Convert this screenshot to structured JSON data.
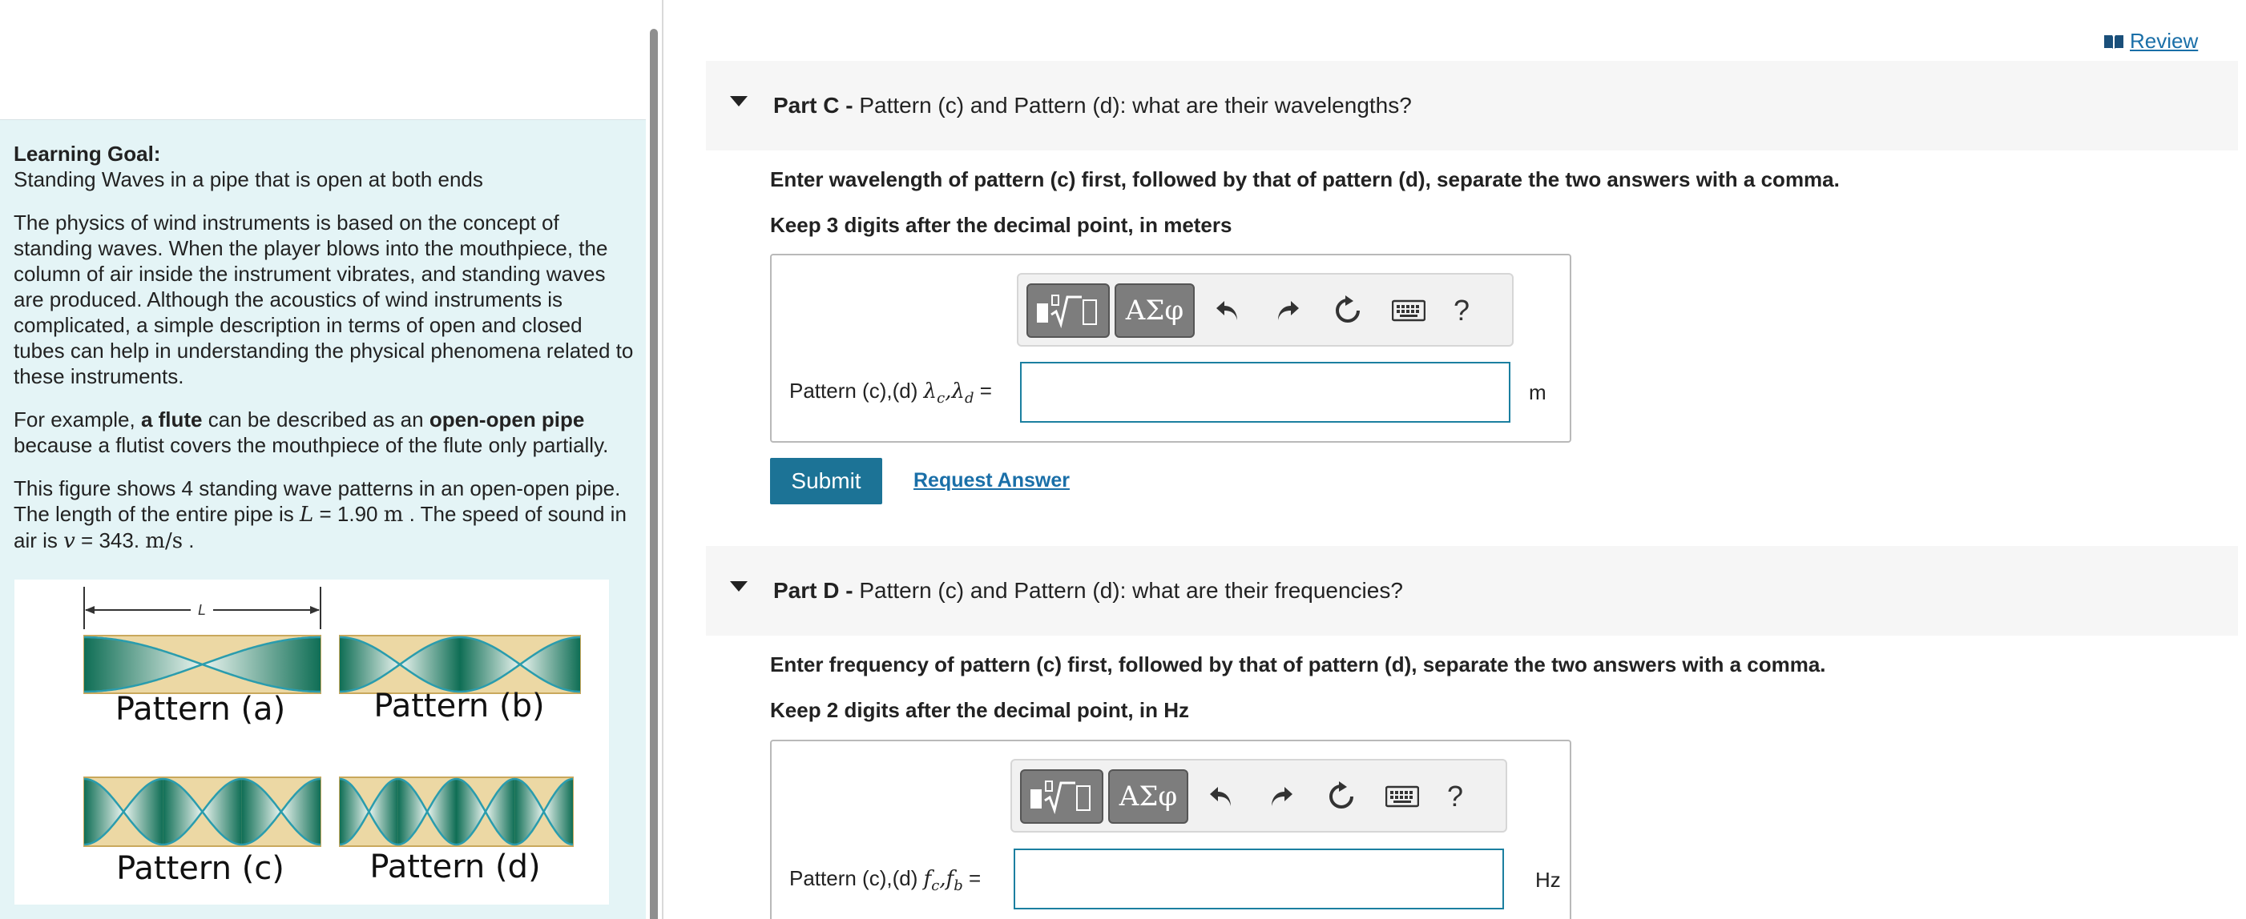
{
  "left": {
    "goal_title": "Learning Goal:",
    "goal_text": "Standing Waves in a pipe that is open at both ends",
    "para1": "The physics of wind instruments is based on the concept of standing waves.  When the player blows into the mouthpiece, the column of air inside the instrument vibrates, and standing waves are produced. Although the acoustics of wind instruments is complicated, a simple description in terms of open and closed  tubes can help in understanding the physical phenomena related to these instruments.",
    "para2_a": "For example, ",
    "para2_b": "a flute",
    "para2_c": " can be described as an ",
    "para2_d": "open-open pipe",
    "para2_e": " because a flutist covers the mouthpiece of the flute only partially.",
    "para3_a": "This figure shows 4 standing wave patterns in an open-open pipe. The length of the entire pipe is ",
    "L_symbol": "L",
    "L_value": " = 1.90 ",
    "L_unit": "m",
    "para3_b": " . The speed of sound in air is ",
    "v_symbol": "v",
    "v_value": " = 343. ",
    "v_unit": "m/s",
    "para3_c": " .",
    "figure": {
      "length_label": "L",
      "patterns": [
        {
          "label": "Pattern (a)",
          "half_wavelengths": 1
        },
        {
          "label": "Pattern (b)",
          "half_wavelengths": 2
        },
        {
          "label": "Pattern (c)",
          "half_wavelengths": 3
        },
        {
          "label": "Pattern (d)",
          "half_wavelengths": 4
        }
      ],
      "colors": {
        "tube": "#ecd8a4",
        "tube_border": "#c9a85c",
        "wave": "#2a9cad",
        "fill_dark": "#0f6e55",
        "fill_light": "#eaf4ef"
      }
    }
  },
  "review": {
    "label": "Review",
    "icon": "book-icon"
  },
  "partC": {
    "part_label": "Part C - ",
    "question": "Pattern (c) and Pattern (d): what are their wavelengths?",
    "instruction1": "Enter wavelength of pattern (c) first, followed by that of pattern (d), separate the two answers with a comma.",
    "instruction2": "Keep 3 digits after the decimal point, in meters",
    "answer_label": "Pattern (c),(d)",
    "var1": "λ",
    "sub1": "c",
    "var2": "λ",
    "sub2": "d",
    "equals": " =",
    "value": "",
    "unit": "m",
    "toolbar_greek": "ΑΣφ",
    "toolbar_help": "?"
  },
  "submit_label": "Submit",
  "request_answer_label": "Request Answer",
  "partD": {
    "part_label": "Part D - ",
    "question": "Pattern (c) and Pattern (d): what are their frequencies?",
    "instruction1": "Enter frequency of pattern (c) first, followed by that of pattern (d), separate the two answers with a comma.",
    "instruction2": "Keep 2 digits after the decimal point, in Hz",
    "answer_label": "Pattern (c),(d)",
    "var1": "f",
    "sub1": "c",
    "var2": "f",
    "sub2": "b",
    "equals": " =",
    "value": "",
    "unit": "Hz",
    "toolbar_greek": "ΑΣφ",
    "toolbar_help": "?"
  }
}
